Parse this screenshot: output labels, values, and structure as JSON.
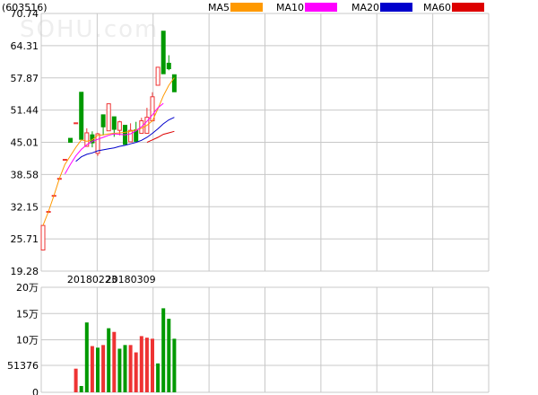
{
  "header": {
    "stock_code": "(603516)",
    "watermark": "SOHU.com"
  },
  "colors": {
    "grid": "#c8c8c8",
    "up": "#ee3333",
    "down": "#009900",
    "ma5": "#ff9900",
    "ma10": "#ff00ff",
    "ma20": "#0000cc",
    "ma60": "#dd0000"
  },
  "chart_data": [
    {
      "type": "candlestick",
      "title": "",
      "legend": [
        "MA5",
        "MA10",
        "MA20",
        "MA60"
      ],
      "legend_position": "top-right",
      "y_ticks": [
        "70.74",
        "64.31",
        "57.87",
        "51.44",
        "45.01",
        "38.58",
        "32.15",
        "25.71",
        "19.28"
      ],
      "ylim": [
        19.28,
        70.74
      ],
      "x_labels": [
        {
          "index": 9,
          "label": "20180223"
        },
        {
          "index": 16,
          "label": "20180309"
        }
      ],
      "grid": true,
      "candles": [
        {
          "o": 23.5,
          "c": 28.4,
          "h": 28.4,
          "l": 23.5
        },
        {
          "o": 31.2,
          "c": 31.2,
          "h": 31.2,
          "l": 31.2
        },
        {
          "o": 34.4,
          "c": 34.4,
          "h": 34.4,
          "l": 34.4
        },
        {
          "o": 37.8,
          "c": 37.8,
          "h": 37.8,
          "l": 37.8
        },
        {
          "o": 41.6,
          "c": 41.6,
          "h": 41.6,
          "l": 41.6
        },
        {
          "o": 45.8,
          "c": 45.0,
          "h": 45.8,
          "l": 45.0
        },
        {
          "o": 48.9,
          "c": 48.9,
          "h": 48.9,
          "l": 48.9
        },
        {
          "o": 55.0,
          "c": 45.6,
          "h": 55.0,
          "l": 45.6
        },
        {
          "o": 44.2,
          "c": 46.9,
          "h": 47.8,
          "l": 44.2
        },
        {
          "o": 46.5,
          "c": 44.9,
          "h": 47.2,
          "l": 44.0
        },
        {
          "o": 42.8,
          "c": 46.7,
          "h": 46.9,
          "l": 42.3
        },
        {
          "o": 50.5,
          "c": 48.1,
          "h": 50.5,
          "l": 46.4
        },
        {
          "o": 47.3,
          "c": 52.7,
          "h": 52.7,
          "l": 47.3
        },
        {
          "o": 50.1,
          "c": 47.6,
          "h": 50.1,
          "l": 46.1
        },
        {
          "o": 47.4,
          "c": 49.1,
          "h": 49.3,
          "l": 46.4
        },
        {
          "o": 48.4,
          "c": 44.6,
          "h": 48.4,
          "l": 44.6
        },
        {
          "o": 45.1,
          "c": 47.4,
          "h": 48.8,
          "l": 45.1
        },
        {
          "o": 47.5,
          "c": 45.2,
          "h": 49.1,
          "l": 45.2
        },
        {
          "o": 46.8,
          "c": 49.3,
          "h": 49.9,
          "l": 46.8
        },
        {
          "o": 46.8,
          "c": 50.0,
          "h": 51.9,
          "l": 46.8
        },
        {
          "o": 49.3,
          "c": 54.1,
          "h": 55.0,
          "l": 49.3
        },
        {
          "o": 56.4,
          "c": 60.0,
          "h": 60.0,
          "l": 56.4
        },
        {
          "o": 67.2,
          "c": 58.7,
          "h": 67.2,
          "l": 58.7
        },
        {
          "o": 60.8,
          "c": 59.7,
          "h": 62.4,
          "l": 59.4
        },
        {
          "o": 58.5,
          "c": 55.1,
          "h": 58.5,
          "l": 55.1
        }
      ],
      "ma_series": [
        {
          "name": "MA5",
          "color": "#ff9900",
          "start": 0,
          "values": [
            28.4,
            31.2,
            34.4,
            37.8,
            40.6,
            42.3,
            44.0,
            45.5,
            45.2,
            45.5,
            46.4,
            46.5,
            46.7,
            46.8,
            46.9,
            47.0,
            47.2,
            47.5,
            47.8,
            48.4,
            49.3,
            51.7,
            54.3,
            56.4,
            57.9
          ]
        },
        {
          "name": "MA10",
          "color": "#ff00ff",
          "start": 4,
          "values": [
            38.7,
            40.6,
            42.3,
            43.6,
            44.5,
            45.2,
            45.6,
            46.0,
            46.4,
            46.7,
            46.6,
            46.5,
            46.7,
            47.3,
            48.1,
            49.2,
            50.5,
            51.9,
            52.8
          ]
        },
        {
          "name": "MA20",
          "color": "#0000cc",
          "start": 6,
          "values": [
            41.2,
            42.1,
            42.6,
            42.9,
            43.3,
            43.5,
            43.7,
            43.9,
            44.2,
            44.4,
            44.7,
            45.0,
            45.4,
            46.0,
            46.8,
            47.7,
            48.7,
            49.5,
            50.0
          ]
        },
        {
          "name": "MA60",
          "color": "#dd0000",
          "start": 19,
          "values": [
            45.0,
            45.5,
            46.0,
            46.6,
            46.9,
            47.2
          ]
        }
      ]
    },
    {
      "type": "bar",
      "title": "",
      "y_ticks": [
        "20万",
        "15万",
        "10万",
        "51376",
        "0"
      ],
      "ylim": [
        0,
        200000
      ],
      "grid": true,
      "volumes": [
        {
          "index": 6,
          "value": 45000,
          "up": true
        },
        {
          "index": 7,
          "value": 12000,
          "up": false
        },
        {
          "index": 8,
          "value": 133000,
          "up": false
        },
        {
          "index": 9,
          "value": 88000,
          "up": true
        },
        {
          "index": 10,
          "value": 85000,
          "up": false
        },
        {
          "index": 11,
          "value": 90000,
          "up": true
        },
        {
          "index": 12,
          "value": 122000,
          "up": false
        },
        {
          "index": 13,
          "value": 115000,
          "up": true
        },
        {
          "index": 14,
          "value": 83000,
          "up": false
        },
        {
          "index": 15,
          "value": 90000,
          "up": false
        },
        {
          "index": 16,
          "value": 90000,
          "up": true
        },
        {
          "index": 17,
          "value": 76000,
          "up": true
        },
        {
          "index": 18,
          "value": 107000,
          "up": true
        },
        {
          "index": 19,
          "value": 104000,
          "up": true
        },
        {
          "index": 20,
          "value": 102000,
          "up": true
        },
        {
          "index": 21,
          "value": 55000,
          "up": false
        },
        {
          "index": 22,
          "value": 160000,
          "up": false
        },
        {
          "index": 23,
          "value": 140000,
          "up": false
        },
        {
          "index": 24,
          "value": 102000,
          "up": false
        }
      ]
    }
  ]
}
